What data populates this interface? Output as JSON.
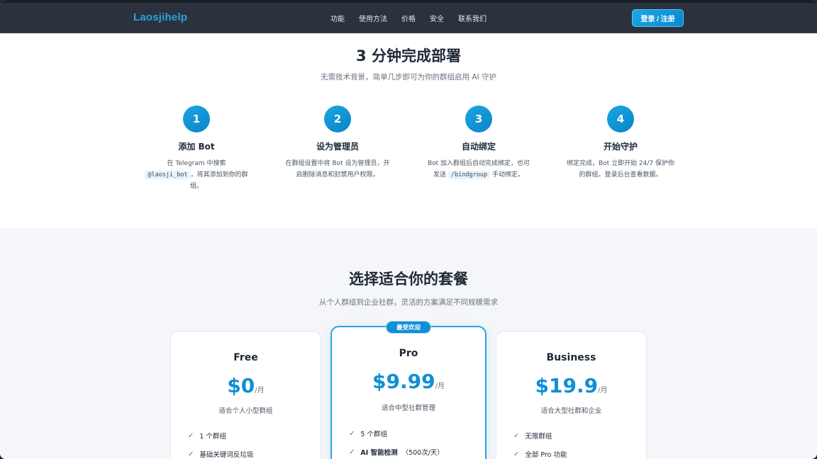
{
  "nav": {
    "logo": "Laosjihelp",
    "menu": [
      "功能",
      "使用方法",
      "价格",
      "安全",
      "联系我们"
    ],
    "login_label": "登录 / 注册"
  },
  "steps": {
    "title": "3 分钟完成部署",
    "subtitle": "无需技术背景，简单几步即可为你的群组启用 AI 守护",
    "items": [
      {
        "num": "1",
        "title": "添加 Bot",
        "desc_pre": "在 Telegram 中搜索",
        "code": "@laosji_bot",
        "desc_post": "，将其添加到你的群组。"
      },
      {
        "num": "2",
        "title": "设为管理员",
        "desc_pre": "在群组设置中将 Bot 设为管理员，开启删除消息和封禁用户权限。",
        "code": "",
        "desc_post": ""
      },
      {
        "num": "3",
        "title": "自动绑定",
        "desc_pre": "Bot 加入群组后自动完成绑定，也可发送",
        "code": "/bindgroup",
        "desc_post": "手动绑定。"
      },
      {
        "num": "4",
        "title": "开始守护",
        "desc_pre": "绑定完成，Bot 立即开始 24/7 保护你的群组。登录后台查看数据。",
        "code": "",
        "desc_post": ""
      }
    ]
  },
  "pricing": {
    "title": "选择适合你的套餐",
    "subtitle": "从个人群组到企业社群，灵活的方案满足不同规模需求",
    "plans": [
      {
        "name": "Free",
        "price": "$0",
        "per": "/月",
        "desc": "适合个人小型群组",
        "features": [
          {
            "bold": "",
            "text": "1 个群组"
          },
          {
            "bold": "",
            "text": "基础关键词反垃圾"
          }
        ]
      },
      {
        "name": "Pro",
        "badge": "最受欢迎",
        "price": "$9.99",
        "per": "/月",
        "desc": "适合中型社群管理",
        "features": [
          {
            "bold": "",
            "text": "5 个群组"
          },
          {
            "bold": "AI 智能检测",
            "text": "（500次/天）"
          }
        ]
      },
      {
        "name": "Business",
        "price": "$19.9",
        "per": "/月",
        "desc": "适合大型社群和企业",
        "features": [
          {
            "bold": "",
            "text": "无限群组"
          },
          {
            "bold": "",
            "text": "全部 Pro 功能"
          }
        ]
      }
    ]
  },
  "colors": {
    "accent": "#0f8fd6",
    "nav_bg": "#2b323e",
    "check": "#22a04b"
  }
}
